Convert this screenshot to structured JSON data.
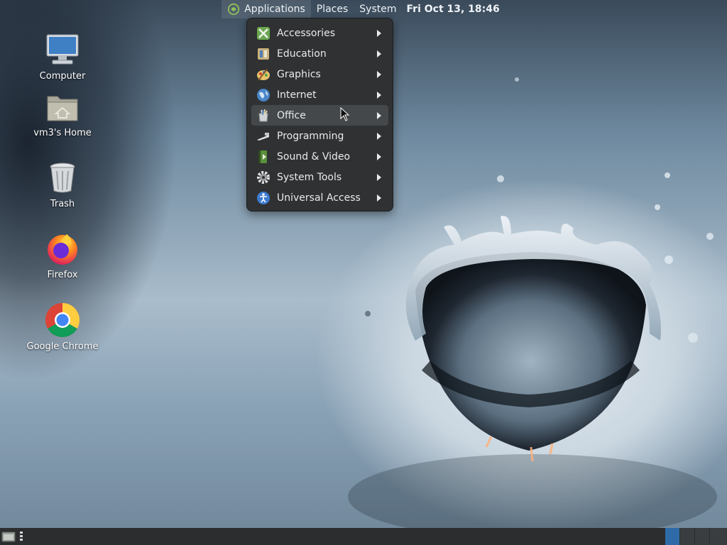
{
  "top_panel": {
    "applications_label": "Applications",
    "places_label": "Places",
    "system_label": "System",
    "clock": "Fri Oct 13, 18:46"
  },
  "desktop_icons": [
    {
      "label": "Computer",
      "icon": "computer-icon"
    },
    {
      "label": "vm3's Home",
      "icon": "home-folder-icon"
    },
    {
      "label": "Trash",
      "icon": "trash-icon"
    },
    {
      "label": "Firefox",
      "icon": "firefox-icon"
    },
    {
      "label": "Google Chrome",
      "icon": "chrome-icon"
    }
  ],
  "app_menu": {
    "items": [
      {
        "label": "Accessories",
        "icon": "accessories-icon"
      },
      {
        "label": "Education",
        "icon": "education-icon"
      },
      {
        "label": "Graphics",
        "icon": "graphics-icon"
      },
      {
        "label": "Internet",
        "icon": "internet-icon"
      },
      {
        "label": "Office",
        "icon": "office-icon",
        "hovered": true
      },
      {
        "label": "Programming",
        "icon": "programming-icon"
      },
      {
        "label": "Sound & Video",
        "icon": "sound-video-icon"
      },
      {
        "label": "System Tools",
        "icon": "system-tools-icon"
      },
      {
        "label": "Universal Access",
        "icon": "universal-access-icon"
      }
    ]
  },
  "bottom_panel": {
    "active_workspace": 1,
    "workspace_count": 4
  },
  "colors": {
    "menu_bg": "#2f3133",
    "menu_hover": "#45484b",
    "panel_bg": "#2b2d2e",
    "active_workspace": "#2f6aa8"
  }
}
